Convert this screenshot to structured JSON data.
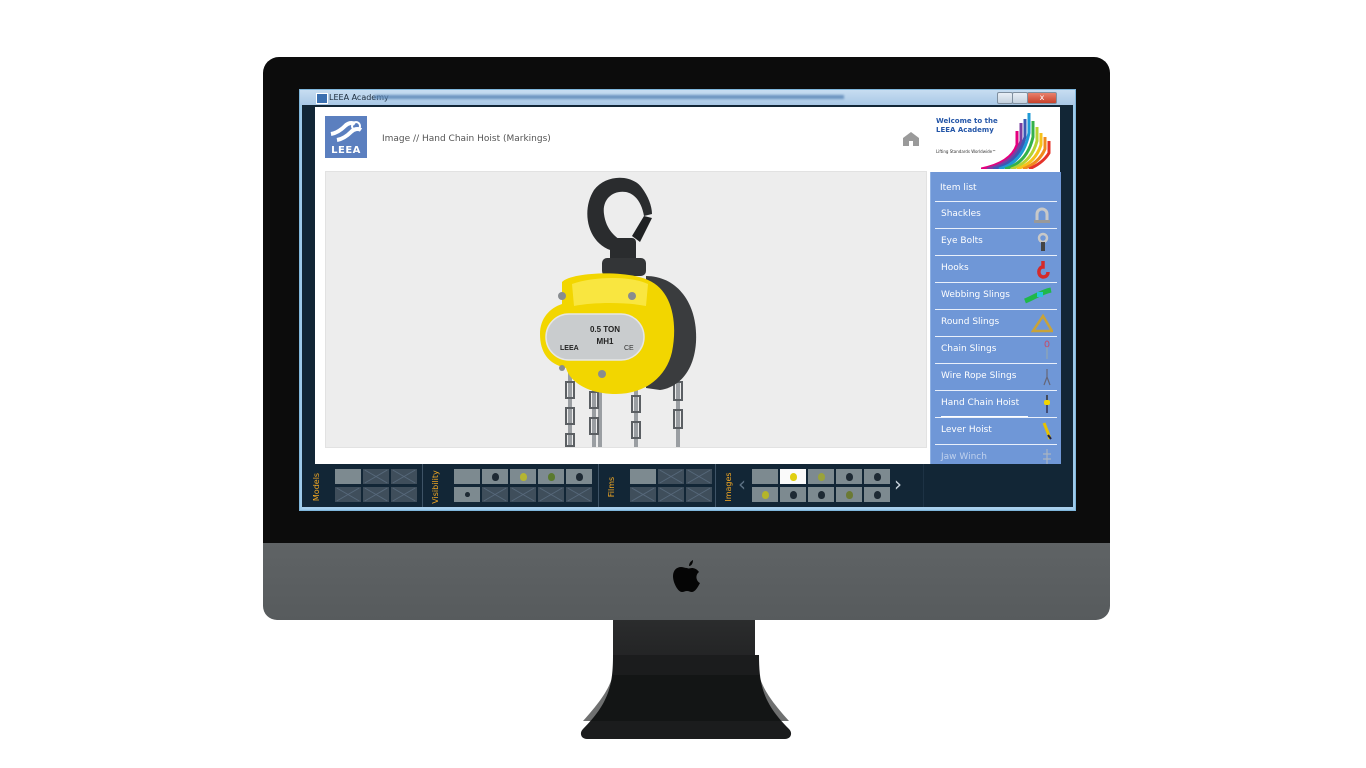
{
  "window": {
    "title": "LEEA Academy",
    "controls": {
      "minimize": "minimize",
      "maximize": "maximize",
      "close": "x"
    }
  },
  "header": {
    "logo_text": "LEEA",
    "breadcrumb": "Image // Hand Chain Hoist (Markings)",
    "home_icon": "home-icon",
    "banner": {
      "welcome": "Welcome to the LEEA Academy",
      "tagline": "Lifting Standards Worldwide™"
    }
  },
  "viewer": {
    "subject": "Hand Chain Hoist",
    "nameplate": {
      "rating": "0.5 TON",
      "model": "MH1",
      "brand": "LEEA",
      "mark": "CE"
    },
    "colors": {
      "body": "#f2d600",
      "hook": "#2a2c2e",
      "background": "#ededed"
    }
  },
  "item_list": {
    "title": "Item list",
    "items": [
      {
        "label": "Shackles",
        "icon": "shackle-icon"
      },
      {
        "label": "Eye Bolts",
        "icon": "eye-bolt-icon"
      },
      {
        "label": "Hooks",
        "icon": "hook-icon"
      },
      {
        "label": "Webbing Slings",
        "icon": "webbing-sling-icon"
      },
      {
        "label": "Round Slings",
        "icon": "round-sling-icon"
      },
      {
        "label": "Chain Slings",
        "icon": "chain-sling-icon"
      },
      {
        "label": "Wire Rope Slings",
        "icon": "wire-rope-sling-icon"
      },
      {
        "label": "Hand Chain Hoist",
        "icon": "hand-chain-hoist-icon",
        "progress": 0.75
      },
      {
        "label": "Lever Hoist",
        "icon": "lever-hoist-icon"
      },
      {
        "label": "Jaw Winch",
        "icon": "jaw-winch-icon"
      }
    ],
    "colors": {
      "background": "#6f97d7",
      "text": "#ffffff"
    }
  },
  "bottom_bar": {
    "groups": [
      {
        "label": "Models",
        "thumbs": [
          "model",
          "empty",
          "empty",
          "empty",
          "empty",
          "empty"
        ]
      },
      {
        "label": "Visibility",
        "thumbs": [
          "model",
          "dark",
          "yellow",
          "green",
          "dark",
          "dark",
          "empty",
          "empty",
          "empty",
          "empty"
        ]
      },
      {
        "label": "Films",
        "thumbs": [
          "model",
          "empty",
          "empty",
          "empty",
          "empty",
          "empty"
        ]
      },
      {
        "label": "Images",
        "thumbs": [
          "model",
          "yellow-selected",
          "olive",
          "dark",
          "dark",
          "yellow",
          "dark",
          "dark",
          "olive",
          "dark"
        ],
        "prev": "‹",
        "next": "›"
      }
    ],
    "colors": {
      "label": "#f1a722",
      "background": "#122636"
    }
  }
}
